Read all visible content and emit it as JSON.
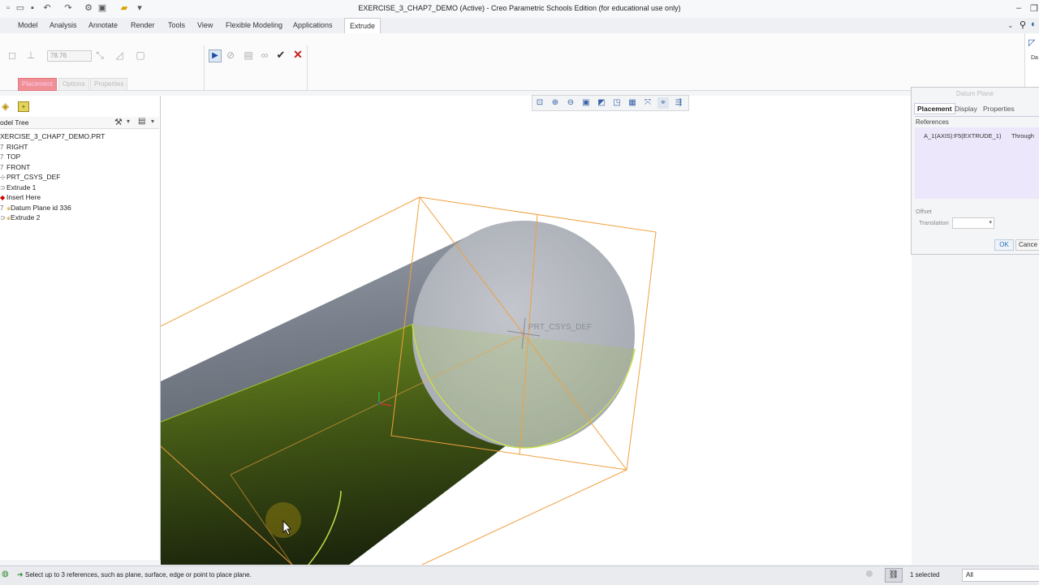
{
  "window": {
    "title": "EXERCISE_3_CHAP7_DEMO (Active) - Creo Parametric Schools Edition (for educational use only)"
  },
  "quick_access_icons": [
    "new-file-icon",
    "open-icon",
    "save-icon",
    "undo-icon",
    "redo-icon",
    "regenerate-icon",
    "window-icon",
    "more-icon"
  ],
  "menu": {
    "tabs": [
      "Model",
      "Analysis",
      "Annotate",
      "Render",
      "Tools",
      "View",
      "Flexible Modeling",
      "Applications",
      "Extrude"
    ],
    "active_tab": "Extrude"
  },
  "ribbon": {
    "depth_value": "78.76",
    "subtabs": [
      "Placement",
      "Options",
      "Properties"
    ],
    "active_subtab": "Placement"
  },
  "model_tree": {
    "header": "odel Tree",
    "items": [
      {
        "label": "XERCISE_3_CHAP7_DEMO.PRT",
        "icon": "part-icon"
      },
      {
        "label": "RIGHT",
        "icon": "datum-plane-icon"
      },
      {
        "label": "TOP",
        "icon": "datum-plane-icon"
      },
      {
        "label": "FRONT",
        "icon": "datum-plane-icon"
      },
      {
        "label": "PRT_CSYS_DEF",
        "icon": "csys-icon"
      },
      {
        "label": "Extrude 1",
        "icon": "extrude-icon"
      },
      {
        "label": "Insert Here",
        "icon": "insert-marker-icon"
      },
      {
        "label": "Datum Plane id 336",
        "icon": "datum-plane-icon"
      },
      {
        "label": "Extrude 2",
        "icon": "extrude-icon"
      }
    ]
  },
  "viewport": {
    "csys_label": "PRT_CSYS_DEF",
    "colors": {
      "cylinder": "#8f959f",
      "highlight": "#a3c62c",
      "datum": "#f0a040",
      "face": "#b8bcc3"
    }
  },
  "datum_dialog": {
    "title": "Datum Plane",
    "tabs": [
      "Placement",
      "Display",
      "Properties"
    ],
    "active_tab": "Placement",
    "references_label": "References",
    "reference": {
      "name": "A_1(AXIS):F5(EXTRUDE_1)",
      "constraint": "Through"
    },
    "offset_label": "Offset",
    "translation_label": "Translation",
    "ok_label": "OK",
    "cancel_label": "Cance"
  },
  "status": {
    "message": "Select up to 3 references, such as plane, surface, edge or point to place plane.",
    "selected": "1 selected",
    "filter": "All"
  }
}
